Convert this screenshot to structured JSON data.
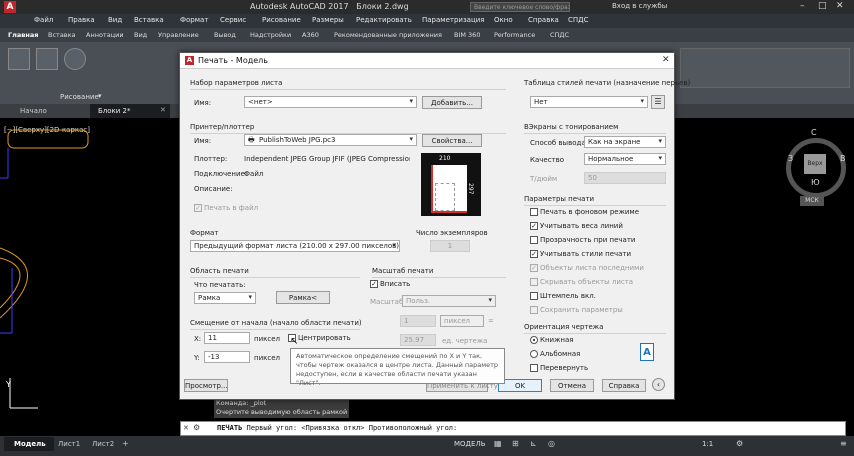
{
  "app": {
    "title": "Autodesk AutoCAD 2017",
    "file": "Блоки 2.dwg",
    "search_placeholder": "Введите ключевое слово/фразу",
    "login": "Вход в службы"
  },
  "menu": [
    "Файл",
    "Правка",
    "Вид",
    "Вставка",
    "Формат",
    "Сервис",
    "Рисование",
    "Размеры",
    "Редактировать",
    "Параметризация",
    "Окно",
    "Справка",
    "СПДС"
  ],
  "ribbon_tabs": [
    "Главная",
    "Вставка",
    "Аннотации",
    "Вид",
    "Управление",
    "Вывод",
    "Надстройки",
    "A360",
    "Рекомендованные приложения",
    "BIM 360",
    "Performance",
    "СПДС"
  ],
  "ribbon_panel_label": "Рисование",
  "file_tabs": [
    "Начало",
    "Блоки 2*"
  ],
  "viewport": {
    "view_label": "[−][Сверху][2D-каркас]",
    "compass": {
      "n": "С",
      "s": "Ю",
      "w": "З",
      "e": "В",
      "top": "Верх"
    },
    "ucs": "МСК"
  },
  "command_history": [
    "Команда: _plot",
    "Очертите выводимую область рамкой"
  ],
  "command_line": {
    "label": "ПЕЧАТЬ",
    "prompt": "Первый угол: <Привязка откл> Противоположный угол:"
  },
  "layout_tabs": [
    "Модель",
    "Лист1",
    "Лист2"
  ],
  "status": {
    "model": "МОДЕЛЬ",
    "scale": "1:1"
  },
  "dialog": {
    "title": "Печать - Модель",
    "page_setup": {
      "section": "Набор параметров листа",
      "name_label": "Имя:",
      "name_value": "<нет>",
      "add_button": "Добавить..."
    },
    "printer": {
      "section": "Принтер/плоттер",
      "name_label": "Имя:",
      "name_value": "PublishToWeb JPG.pc3",
      "properties_button": "Свойства...",
      "plotter_label": "Плоттер:",
      "plotter_value": "Independent JPEG Group JFIF (JPEG Compression) -...",
      "connection_label": "Подключение:",
      "connection_value": "Файл",
      "description_label": "Описание:",
      "print_to_file": "Печать в файл",
      "preview_width": "210",
      "preview_height": "297"
    },
    "format": {
      "section": "Формат",
      "value": "Предыдущий формат листа  (210.00 x 297.00 пикселов)"
    },
    "copies": {
      "label": "Число экземпляров",
      "value": "1"
    },
    "plot_area": {
      "section": "Область печати",
      "what_label": "Что печатать:",
      "what_value": "Рамка",
      "frame_button": "Рамка<"
    },
    "plot_scale": {
      "section": "Масштаб печати",
      "fit": "Вписать",
      "scale_label": "Масштаб:",
      "scale_value": "Польз.",
      "value1": "1",
      "unit1": "пиксел",
      "value2": "25.97",
      "unit2": "ед. чертежа"
    },
    "offset": {
      "section": "Смещение от начала (начало области печати)",
      "x_label": "X:",
      "x_value": "11",
      "y_label": "Y:",
      "y_value": "-13",
      "unit": "пиксел",
      "center": "Центрировать"
    },
    "tooltip": "Автоматическое определение смещений по X и Y так, чтобы чертеж оказался в центре листа. Данный параметр недоступен, если в качестве области печати указан \"Лист\".",
    "preview_button": "Просмотр...",
    "apply_button": "Применить к листу",
    "ok_button": "OK",
    "cancel_button": "Отмена",
    "help_button": "Справка",
    "style_table": {
      "section": "Таблица стилей печати (назначение перьев)",
      "value": "Нет"
    },
    "shaded": {
      "section": "ВЭкраны с тонированием",
      "mode_label": "Способ вывода",
      "mode_value": "Как на экране",
      "quality_label": "Качество",
      "quality_value": "Нормальное",
      "dpi_label": "Т/дюйм",
      "dpi_value": "50"
    },
    "print_options": {
      "section": "Параметры печати",
      "items": [
        {
          "label": "Печать в фоновом режиме",
          "checked": "",
          "disabled": false
        },
        {
          "label": "Учитывать веса линий",
          "checked": "✓",
          "disabled": false
        },
        {
          "label": "Прозрачность при печати",
          "checked": "",
          "disabled": false
        },
        {
          "label": "Учитывать стили печати",
          "checked": "✓",
          "disabled": false
        },
        {
          "label": "Объекты листа последними",
          "checked": "✓",
          "disabled": true
        },
        {
          "label": "Скрывать объекты листа",
          "checked": "",
          "disabled": true
        },
        {
          "label": "Штемпель вкл.",
          "checked": "",
          "disabled": false
        },
        {
          "label": "Сохранить параметры",
          "checked": "",
          "disabled": true
        }
      ]
    },
    "orientation": {
      "section": "Ориентация чертежа",
      "portrait": "Книжная",
      "landscape": "Альбомная",
      "upside_down": "Перевернуть"
    }
  },
  "colors": {
    "accent": "#1e73be",
    "paper_margin": "#d62d2d"
  }
}
